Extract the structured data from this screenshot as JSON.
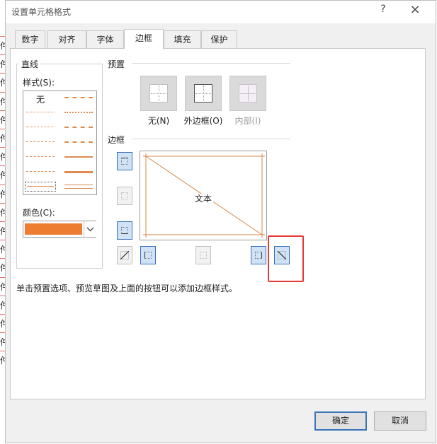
{
  "background_cells": [
    "件",
    "件",
    "件",
    "件",
    "件",
    "件",
    "件",
    "件",
    "件",
    "件",
    "件",
    "件",
    "件",
    "件",
    "件",
    "件",
    "件",
    "件"
  ],
  "dialog": {
    "title": "设置单元格格式",
    "help_label": "?",
    "close_label": "×"
  },
  "tabs": [
    "数字",
    "对齐",
    "字体",
    "边框",
    "填充",
    "保护"
  ],
  "active_tab": "边框",
  "line_group": {
    "label": "直线",
    "style_label": "样式(S):",
    "none_label": "无",
    "color_label": "颜色(C):",
    "color_value": "#ed7d31"
  },
  "presets": {
    "label": "预置",
    "items": [
      {
        "label": "无(N)",
        "enabled": true
      },
      {
        "label": "外边框(O)",
        "enabled": true
      },
      {
        "label": "内部(I)",
        "enabled": false
      }
    ]
  },
  "border": {
    "label": "边框",
    "preview_text": "文本",
    "line_color": "#d4894a"
  },
  "hint": "单击预置选项、预览草图及上面的按钮可以添加边框样式。",
  "buttons": {
    "ok": "确定",
    "cancel": "取消"
  },
  "accent_color": "#3b73b9",
  "highlight_color": "#e53935"
}
